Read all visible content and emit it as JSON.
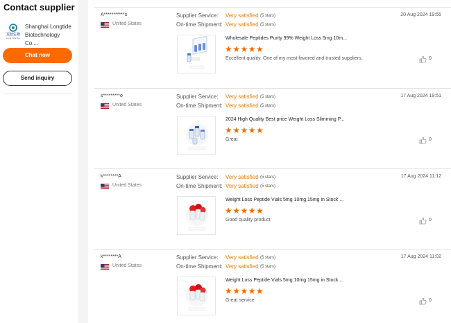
{
  "sidebar": {
    "title": "Contact supplier",
    "supplier_name": "Shanghai Longtide Biotechnology Co....",
    "logo_text": "龙肽生物",
    "logo_subtext": "Long Tide Bio",
    "chat_button": "Chat now",
    "inquiry_button": "Send inquiry"
  },
  "labels": {
    "supplier_service": "Supplier Service:",
    "ontime_shipment": "On-time Shipment:"
  },
  "reviews": [
    {
      "reviewer": "A***********s",
      "country": "United States",
      "service_rating": "Very satisfied",
      "service_stars": "(5 stars)",
      "shipment_rating": "Very satisfied",
      "shipment_stars": "(5 stars)",
      "date": "20 Aug 2024 19:55",
      "product": "Wholesale Peptides Purity 99% Weight Loss 5mg 10m...",
      "stars": "★★★★★",
      "rating": 5,
      "comment": "Excellent quality. One of my most favored and trusted suppliers.",
      "likes": "0",
      "thumb_icon": "vials-box-icon"
    },
    {
      "reviewer": "s*********o",
      "country": "United States",
      "service_rating": "Very satisfied",
      "service_stars": "(5 stars)",
      "shipment_rating": "Very satisfied",
      "shipment_stars": "(5 stars)",
      "date": "17 Aug 2024 19:51",
      "product": "2024 High Quality Best price Weight Loss Slimming P...",
      "stars": "★★★★★",
      "rating": 5,
      "comment": "Great",
      "likes": "0",
      "thumb_icon": "blue-vials-icon"
    },
    {
      "reviewer": "k********A",
      "country": "United States",
      "service_rating": "Very satisfied",
      "service_stars": "(5 stars)",
      "shipment_rating": "Very satisfied",
      "shipment_stars": "(5 stars)",
      "date": "17 Aug 2024 11:12",
      "product": "Weight Loss Peptide Vials 5mg 10mg 15mg in Stock ...",
      "stars": "★★★★★",
      "rating": 5,
      "comment": "Good quality product",
      "likes": "0",
      "thumb_icon": "red-vials-icon"
    },
    {
      "reviewer": "k********A",
      "country": "United States",
      "service_rating": "Very satisfied",
      "service_stars": "(5 stars)",
      "shipment_rating": "Very satisfied",
      "shipment_stars": "(5 stars)",
      "date": "17 Aug 2024 11:02",
      "product": "Weight Loss Peptide Vials 5mg 10mg 15mg in Stock ...",
      "stars": "★★★★★",
      "rating": 5,
      "comment": "Great service",
      "likes": "0",
      "thumb_icon": "red-vials-icon"
    }
  ],
  "colors": {
    "accent": "#ff6a00",
    "rating_text": "#f07a00",
    "star": "#f26b00"
  }
}
